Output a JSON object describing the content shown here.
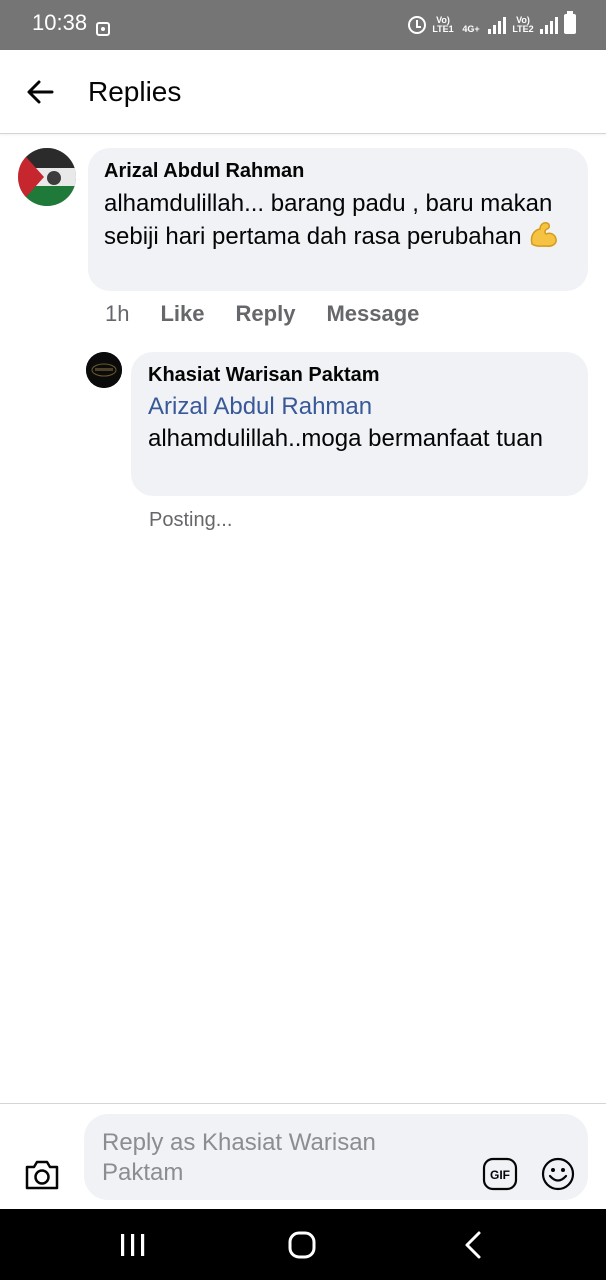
{
  "status_bar": {
    "time": "10:38",
    "sim1_label": "Vo) LTE1",
    "sim2_label": "Vo) LTE2",
    "network": "4G+"
  },
  "header": {
    "title": "Replies",
    "back_icon": "arrow-left-icon"
  },
  "comment": {
    "author": "Arizal Abdul Rahman",
    "text": "alhamdulillah... barang padu , baru makan sebiji hari pertama dah rasa perubahan",
    "emoji": "flexed-biceps",
    "time": "1h",
    "actions": [
      "Like",
      "Reply",
      "Message"
    ]
  },
  "reply": {
    "author": "Khasiat Warisan Paktam",
    "mention": "Arizal Abdul Rahman",
    "text": "alhamdulillah..moga bermanfaat tuan",
    "status": "Posting..."
  },
  "composer": {
    "placeholder": "Reply as Khasiat Warisan Paktam",
    "gif_label": "GIF",
    "icons": [
      "camera-icon",
      "gif-icon",
      "smile-icon"
    ]
  },
  "colors": {
    "status_bar_bg": "#757575",
    "bubble_bg": "#f0f2f5",
    "mention": "#385898",
    "secondary_text": "#65676b"
  }
}
